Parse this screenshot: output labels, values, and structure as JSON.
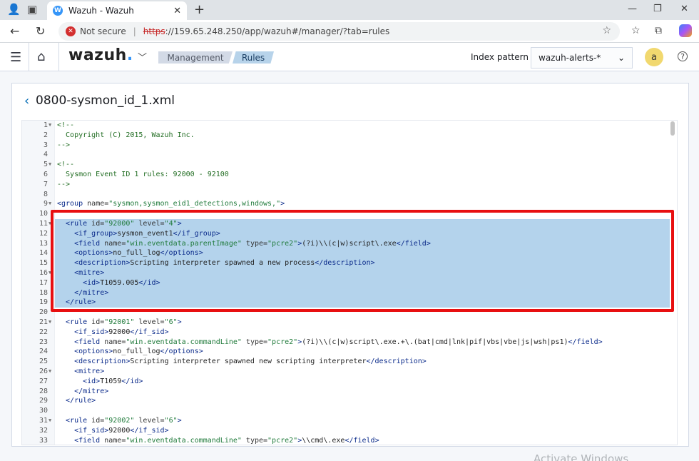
{
  "browser": {
    "tab_title": "Wazuh - Wazuh",
    "tab_favicon_letter": "W",
    "not_secure": "Not secure",
    "url_scheme": "https",
    "url_rest": "://159.65.248.250/app/wazuh#/manager/?tab=rules"
  },
  "app": {
    "logo": "wazuh",
    "logo_dot": ".",
    "breadcrumb": [
      "Management",
      "Rules"
    ],
    "index_pattern_label": "Index pattern",
    "index_pattern_value": "wazuh-alerts-*",
    "avatar_letter": "a"
  },
  "file": {
    "title": "0800-sysmon_id_1.xml"
  },
  "editor": {
    "lines": [
      {
        "n": "1",
        "fold": true,
        "segs": [
          [
            "cm",
            "<!--"
          ]
        ]
      },
      {
        "n": "2",
        "segs": [
          [
            "cm",
            "  Copyright (C) 2015, Wazuh Inc."
          ]
        ]
      },
      {
        "n": "3",
        "segs": [
          [
            "cm",
            "-->"
          ]
        ]
      },
      {
        "n": "4",
        "segs": []
      },
      {
        "n": "5",
        "fold": true,
        "segs": [
          [
            "cm",
            "<!--"
          ]
        ]
      },
      {
        "n": "6",
        "segs": [
          [
            "cm",
            "  Sysmon Event ID 1 rules: 92000 - 92100"
          ]
        ]
      },
      {
        "n": "7",
        "segs": [
          [
            "cm",
            "-->"
          ]
        ]
      },
      {
        "n": "8",
        "segs": []
      },
      {
        "n": "9",
        "fold": true,
        "segs": [
          [
            "tg",
            "<group "
          ],
          [
            "at",
            "name="
          ],
          [
            "st",
            "\"sysmon,sysmon_eid1_detections,windows,\""
          ],
          [
            "tg",
            ">"
          ]
        ]
      },
      {
        "n": "10",
        "segs": []
      },
      {
        "n": "11",
        "fold": true,
        "segs": [
          [
            "tg",
            "  <rule "
          ],
          [
            "at",
            "id="
          ],
          [
            "st",
            "\"92000\""
          ],
          [
            "at",
            " level="
          ],
          [
            "st",
            "\"4\""
          ],
          [
            "tg",
            ">"
          ]
        ]
      },
      {
        "n": "12",
        "segs": [
          [
            "tg",
            "    <if_group>"
          ],
          [
            "tx",
            "sysmon_event1"
          ],
          [
            "tg",
            "</if_group>"
          ]
        ]
      },
      {
        "n": "13",
        "segs": [
          [
            "tg",
            "    <field "
          ],
          [
            "at",
            "name="
          ],
          [
            "st",
            "\"win.eventdata.parentImage\""
          ],
          [
            "at",
            " type="
          ],
          [
            "st",
            "\"pcre2\""
          ],
          [
            "tg",
            ">"
          ],
          [
            "tx",
            "(?i)\\\\(c|w)script\\.exe"
          ],
          [
            "tg",
            "</field>"
          ]
        ]
      },
      {
        "n": "14",
        "segs": [
          [
            "tg",
            "    <options>"
          ],
          [
            "tx",
            "no_full_log"
          ],
          [
            "tg",
            "</options>"
          ]
        ]
      },
      {
        "n": "15",
        "segs": [
          [
            "tg",
            "    <description>"
          ],
          [
            "tx",
            "Scripting interpreter spawned a new process"
          ],
          [
            "tg",
            "</description>"
          ]
        ]
      },
      {
        "n": "16",
        "fold": true,
        "segs": [
          [
            "tg",
            "    <mitre>"
          ]
        ]
      },
      {
        "n": "17",
        "segs": [
          [
            "tg",
            "      <id>"
          ],
          [
            "tx",
            "T1059.005"
          ],
          [
            "tg",
            "</id>"
          ]
        ]
      },
      {
        "n": "18",
        "segs": [
          [
            "tg",
            "    </mitre>"
          ]
        ]
      },
      {
        "n": "19",
        "segs": [
          [
            "tg",
            "  </rule>"
          ]
        ]
      },
      {
        "n": "20",
        "segs": []
      },
      {
        "n": "21",
        "fold": true,
        "segs": [
          [
            "tg",
            "  <rule "
          ],
          [
            "at",
            "id="
          ],
          [
            "st",
            "\"92001\""
          ],
          [
            "at",
            " level="
          ],
          [
            "st",
            "\"6\""
          ],
          [
            "tg",
            ">"
          ]
        ]
      },
      {
        "n": "22",
        "segs": [
          [
            "tg",
            "    <if_sid>"
          ],
          [
            "tx",
            "92000"
          ],
          [
            "tg",
            "</if_sid>"
          ]
        ]
      },
      {
        "n": "23",
        "segs": [
          [
            "tg",
            "    <field "
          ],
          [
            "at",
            "name="
          ],
          [
            "st",
            "\"win.eventdata.commandLine\""
          ],
          [
            "at",
            " type="
          ],
          [
            "st",
            "\"pcre2\""
          ],
          [
            "tg",
            ">"
          ],
          [
            "tx",
            "(?i)\\\\(c|w)script\\.exe.+\\.(bat|cmd|lnk|pif|vbs|vbe|js|wsh|ps1)"
          ],
          [
            "tg",
            "</field>"
          ]
        ]
      },
      {
        "n": "24",
        "segs": [
          [
            "tg",
            "    <options>"
          ],
          [
            "tx",
            "no_full_log"
          ],
          [
            "tg",
            "</options>"
          ]
        ]
      },
      {
        "n": "25",
        "segs": [
          [
            "tg",
            "    <description>"
          ],
          [
            "tx",
            "Scripting interpreter spawned new scripting interpreter"
          ],
          [
            "tg",
            "</description>"
          ]
        ]
      },
      {
        "n": "26",
        "fold": true,
        "segs": [
          [
            "tg",
            "    <mitre>"
          ]
        ]
      },
      {
        "n": "27",
        "segs": [
          [
            "tg",
            "      <id>"
          ],
          [
            "tx",
            "T1059"
          ],
          [
            "tg",
            "</id>"
          ]
        ]
      },
      {
        "n": "28",
        "segs": [
          [
            "tg",
            "    </mitre>"
          ]
        ]
      },
      {
        "n": "29",
        "segs": [
          [
            "tg",
            "  </rule>"
          ]
        ]
      },
      {
        "n": "30",
        "segs": []
      },
      {
        "n": "31",
        "fold": true,
        "segs": [
          [
            "tg",
            "  <rule "
          ],
          [
            "at",
            "id="
          ],
          [
            "st",
            "\"92002\""
          ],
          [
            "at",
            " level="
          ],
          [
            "st",
            "\"6\""
          ],
          [
            "tg",
            ">"
          ]
        ]
      },
      {
        "n": "32",
        "segs": [
          [
            "tg",
            "    <if_sid>"
          ],
          [
            "tx",
            "92000"
          ],
          [
            "tg",
            "</if_sid>"
          ]
        ]
      },
      {
        "n": "33",
        "segs": [
          [
            "tg",
            "    <field "
          ],
          [
            "at",
            "name="
          ],
          [
            "st",
            "\"win.eventdata.commandLine\""
          ],
          [
            "at",
            " type="
          ],
          [
            "st",
            "\"pcre2\""
          ],
          [
            "tg",
            ">"
          ],
          [
            "tx",
            "\\\\cmd\\.exe"
          ],
          [
            "tg",
            "</field>"
          ]
        ]
      }
    ]
  },
  "watermark": "Activate Windows"
}
